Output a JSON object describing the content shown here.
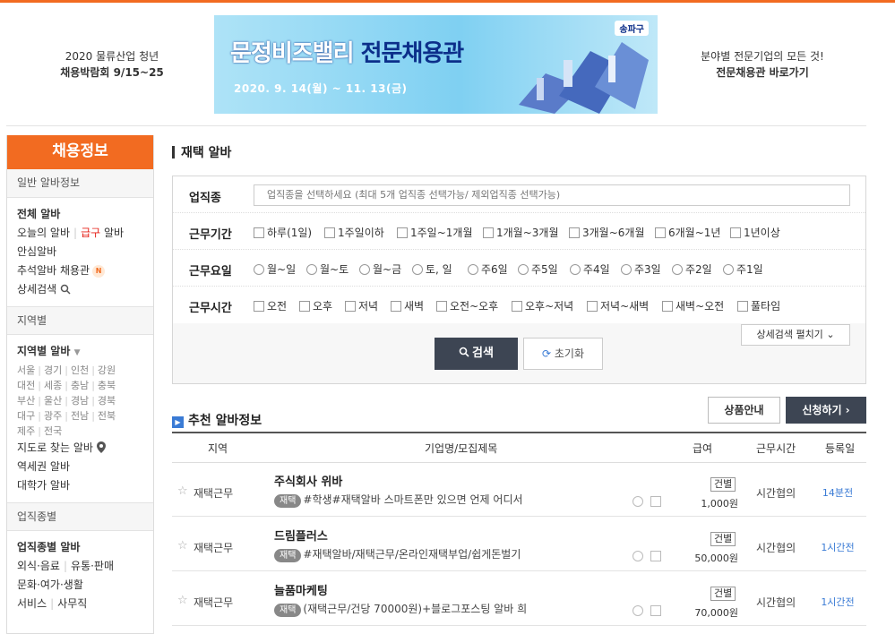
{
  "header": {
    "left_line1": "2020 물류산업 청년",
    "left_line2": "채용박람회 9/15~25",
    "banner_title_a": "문정비즈밸리 ",
    "banner_title_b": "전문채용관",
    "banner_date": "2020. 9. 14(월) ~ 11. 13(금)",
    "banner_badge": "송파구",
    "right_line1": "분야별 전문기업의 모든 것!",
    "right_line2": "전문채용관 바로가기"
  },
  "sidebar": {
    "title": "채용정보",
    "sec1": {
      "header": "일반 알바정보",
      "items": [
        "전체 알바",
        "오늘의 알바",
        "급구",
        "알바",
        "안심알바",
        "추석알바 채용관",
        "상세검색"
      ],
      "badge": "N"
    },
    "sec2": {
      "header": "지역별",
      "title": "지역별 알바",
      "regions_r1": [
        "서울",
        "경기",
        "인천",
        "강원"
      ],
      "regions_r2": [
        "대전",
        "세종",
        "충남",
        "충북"
      ],
      "regions_r3": [
        "부산",
        "울산",
        "경남",
        "경북"
      ],
      "regions_r4": [
        "대구",
        "광주",
        "전남",
        "전북"
      ],
      "regions_r5": [
        "제주",
        "전국"
      ],
      "items": [
        "지도로 찾는 알바",
        "역세권 알바",
        "대학가 알바"
      ]
    },
    "sec3": {
      "header": "업직종별",
      "title": "업직종별 알바",
      "items": [
        "외식·음료",
        "유통·판매",
        "문화·여가·생활",
        "서비스",
        "사무직"
      ]
    }
  },
  "main": {
    "title": "재택 알바",
    "filter": {
      "job_label": "업직종",
      "job_placeholder": "업직종을 선택하세요 (최대 5개 업직종 선택가능/ 제외업직종 선택가능)",
      "period_label": "근무기간",
      "period": [
        "하루(1일)",
        "1주일이하",
        "1주일~1개월",
        "1개월~3개월",
        "3개월~6개월",
        "6개월~1년",
        "1년이상"
      ],
      "days_label": "근무요일",
      "days": [
        "월~일",
        "월~토",
        "월~금",
        "토, 일",
        "주6일",
        "주5일",
        "주4일",
        "주3일",
        "주2일",
        "주1일"
      ],
      "time_label": "근무시간",
      "times": [
        "오전",
        "오후",
        "저녁",
        "새벽",
        "오전~오후",
        "오후~저녁",
        "저녁~새벽",
        "새벽~오전",
        "풀타임"
      ],
      "detail_toggle": "상세검색 펼치기",
      "search": "검색",
      "reset": "초기화"
    },
    "recommend": {
      "title": "추천 알바정보",
      "product_btn": "상품안내",
      "apply_btn": "신청하기 ›",
      "columns": [
        "지역",
        "기업명/모집제목",
        "급여",
        "근무시간",
        "등록일"
      ],
      "rows": [
        {
          "loc": "재택근무",
          "company": "주식회사 위바",
          "tag": "재택",
          "desc": "#학생#재택알바 스마트폰만 있으면 언제 어디서",
          "pay_type": "건별",
          "pay": "1,000원",
          "hours": "시간협의",
          "reg": "14분전"
        },
        {
          "loc": "재택근무",
          "company": "드림플러스",
          "tag": "재택",
          "desc": "#재택알바/재택근무/온라인재택부업/쉽게돈벌기",
          "pay_type": "건별",
          "pay": "50,000원",
          "hours": "시간협의",
          "reg": "1시간전"
        },
        {
          "loc": "재택근무",
          "company": "늘품마케팅",
          "tag": "재택",
          "desc": "(재택근무/건당 70000원)+블로그포스팅 알바 희",
          "pay_type": "건별",
          "pay": "70,000원",
          "hours": "시간협의",
          "reg": "1시간전"
        }
      ]
    }
  }
}
